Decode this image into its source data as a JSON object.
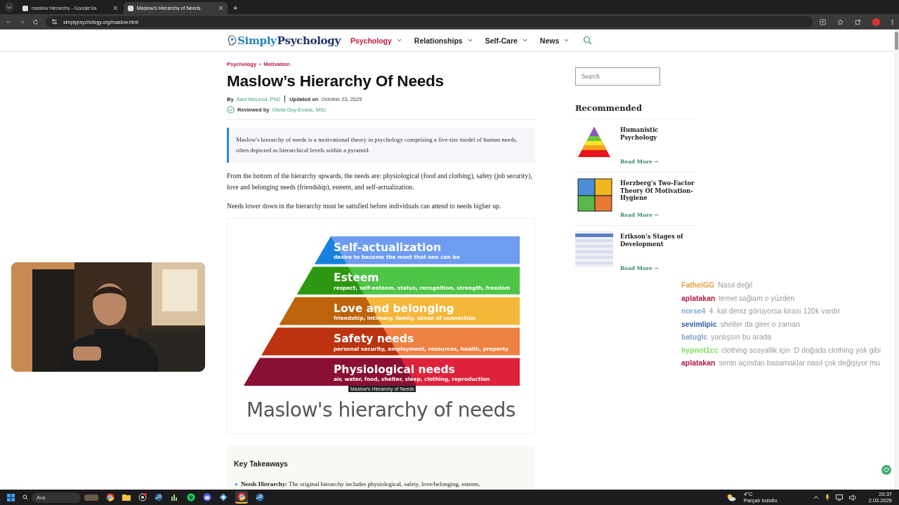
{
  "browser": {
    "tabs": [
      {
        "title": "maslow hierarchy - Google'da",
        "selected": false
      },
      {
        "title": "Maslow’s Hierarchy of Needs",
        "selected": true
      }
    ],
    "new_tab": "+",
    "url": "simplypsychology.org/maslow.html"
  },
  "site": {
    "logo": {
      "part_1": "Simply",
      "part_2": "Psychology"
    },
    "nav": [
      {
        "label": "Psychology",
        "selected": true
      },
      {
        "label": "Relationships",
        "selected": false
      },
      {
        "label": "Self-Care",
        "selected": false
      },
      {
        "label": "News",
        "selected": false
      }
    ]
  },
  "article": {
    "breadcrumb": [
      "Psychology",
      "Motivation"
    ],
    "separator": "»",
    "title": "Maslow’s Hierarchy Of Needs",
    "byline": {
      "by": "By",
      "author": "Saul McLeod, PhD",
      "updated_label": "Updated on",
      "updated": "October 23, 2025",
      "reviewed_label": "Reviewed by",
      "reviewer": "Olivia Guy-Evans, MSc"
    },
    "summary": "Maslow's hierarchy of needs is a motivational theory in psychology comprising a five-tier model of human needs, often depicted as hierarchical levels within a pyramid.",
    "paragraphs": [
      "From the bottom of the hierarchy upwards, the needs are: physiological (food and clothing), safety (job security), love and belonging needs (friendship), esteem, and self-actualization.",
      "Needs lower down in the hierarchy must be satisfied before individuals can attend to needs higher up."
    ],
    "figure": {
      "tiers": [
        {
          "title": "Self-actualization",
          "subtitle": "desire to become the most that one can be",
          "color": "#6d9cf0"
        },
        {
          "title": "Esteem",
          "subtitle": "respect, self-esteem, status, recognition, strength, freedom",
          "color": "#4ec547"
        },
        {
          "title": "Love and belonging",
          "subtitle": "friendship, intimacy, family, sense of connection",
          "color": "#f4b73a"
        },
        {
          "title": "Safety needs",
          "subtitle": "personal security, employment, resources, health, property",
          "color": "#ef8142"
        },
        {
          "title": "Physiological needs",
          "subtitle": "air, water, food, shelter, sleep, clothing, reproduction",
          "color": "#e0213a"
        }
      ],
      "tooltip": "Maslow's Hierarchy of Needs",
      "caption": "Maslow's hierarchy of needs"
    },
    "key_takeaways": {
      "title": "Key Takeaways",
      "items": [
        "**Needs Hierarchy:** The original hierarchy includes physiological, safety, love/belonging, esteem,"
      ]
    }
  },
  "sidebar": {
    "search": {
      "placeholder": "Search"
    },
    "title": "Recommended",
    "items": [
      {
        "title": "Humanistic Psychology",
        "link": "Read More →"
      },
      {
        "title": "Herzberg's Two-Factor Theory Of Motivation-Hygiene",
        "link": "Read More →"
      },
      {
        "title": "Erikson's Stages of Development",
        "link": "Read More →"
      }
    ]
  },
  "chat": [
    {
      "user": "FathelGG",
      "color": "#e3a03e",
      "message": "Nasıl değil"
    },
    {
      "user": "aplatakan",
      "color": "#b3173f",
      "message": "temel sağlam o yüzden"
    },
    {
      "user": "norse4",
      "color": "#86a8d8",
      "message": "4. kat deniz görüyorsa kirası 120k vardır"
    },
    {
      "user": "sevimlipic",
      "color": "#2f5fa8",
      "message": "shelter da girer o zaman"
    },
    {
      "user": "batuglc",
      "color": "#7f9fd0",
      "message": "yanlışsın bu arada"
    },
    {
      "user": "hypnot1cc",
      "color": "#7ee05e",
      "message": "clothing sosyallik için :D doğada clothing yok gibi"
    },
    {
      "user": "aplatakan",
      "color": "#b3173f",
      "message": "senin açından basamaklar nasıl çok değişiyor mu"
    }
  ],
  "taskbar": {
    "search": {
      "placeholder": "Ara"
    },
    "weather": {
      "temp": "4°C",
      "condition": "Parçalı bulutlu"
    },
    "clock": {
      "time": "20:37",
      "date": "2.03.2026"
    }
  }
}
